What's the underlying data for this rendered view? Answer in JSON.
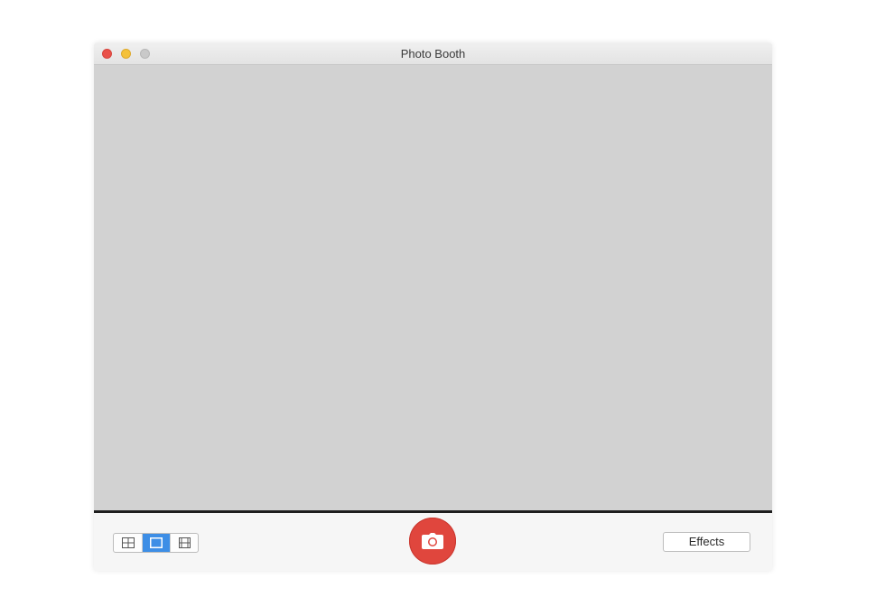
{
  "window": {
    "title": "Photo Booth"
  },
  "toolbar": {
    "layout_modes": [
      {
        "name": "four-up",
        "icon": "grid-icon",
        "selected": false
      },
      {
        "name": "single",
        "icon": "single-frame-icon",
        "selected": true
      },
      {
        "name": "video",
        "icon": "film-strip-icon",
        "selected": false
      }
    ],
    "shutter_icon": "camera-icon",
    "effects_label": "Effects"
  },
  "colors": {
    "shutter": "#e0463d",
    "selected_segment": "#3d8ee6",
    "preview_background": "#d2d2d2",
    "close": "#e9514a",
    "minimize": "#f4c13a",
    "zoom": "#c9c9c9"
  }
}
